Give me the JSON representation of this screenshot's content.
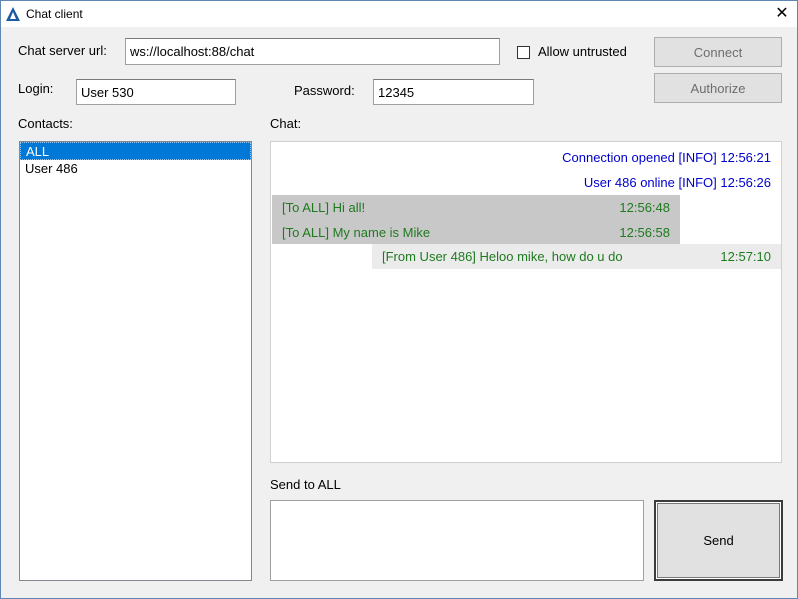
{
  "window": {
    "title": "Chat client",
    "close_glyph": "✕"
  },
  "connection": {
    "server_url_label": "Chat server url:",
    "server_url_value": "ws://localhost:88/chat",
    "allow_untrusted_label": "Allow untrusted",
    "allow_untrusted_checked": false,
    "connect_label": "Connect",
    "authorize_label": "Authorize"
  },
  "auth": {
    "login_label": "Login:",
    "login_value": "User 530",
    "password_label": "Password:",
    "password_value": "12345"
  },
  "contacts": {
    "label": "Contacts:",
    "items": [
      {
        "name": "ALL",
        "selected": true
      },
      {
        "name": "User 486",
        "selected": false
      }
    ]
  },
  "chat": {
    "label": "Chat:",
    "messages": [
      {
        "kind": "info",
        "text": "Connection opened [INFO] 12:56:21"
      },
      {
        "kind": "info",
        "text": "User 486 online [INFO] 12:56:26"
      },
      {
        "kind": "sent",
        "text": "[To ALL] Hi all!",
        "time": "12:56:48"
      },
      {
        "kind": "sent",
        "text": "[To ALL] My name is Mike",
        "time": "12:56:58"
      },
      {
        "kind": "recv",
        "text": "[From User 486] Heloo mike, how do u do",
        "time": "12:57:10"
      }
    ]
  },
  "composer": {
    "label": "Send to ALL",
    "value": "",
    "send_label": "Send"
  },
  "colors": {
    "info_text": "#0000cc",
    "message_text": "#1f7a1f",
    "selection": "#0078d7",
    "app_icon": "#1b5a9e"
  }
}
